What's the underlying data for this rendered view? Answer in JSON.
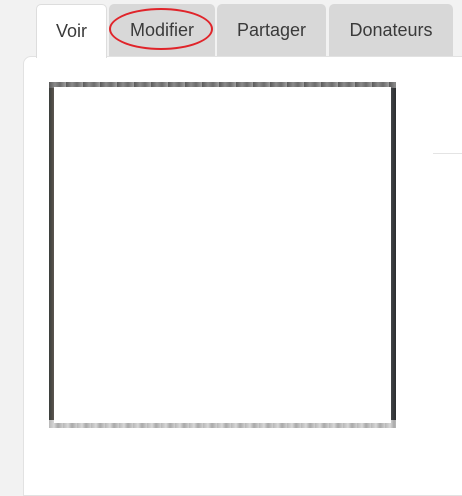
{
  "tabs": {
    "voir": "Voir",
    "modifier": "Modifier",
    "partager": "Partager",
    "donateurs": "Donateurs"
  },
  "active_tab": "Voir",
  "highlighted_tab": "Modifier",
  "colors": {
    "highlight": "#e0242a",
    "tab_inactive": "#d8d8d8",
    "tab_active": "#ffffff",
    "page_background": "#f2f2f2"
  }
}
